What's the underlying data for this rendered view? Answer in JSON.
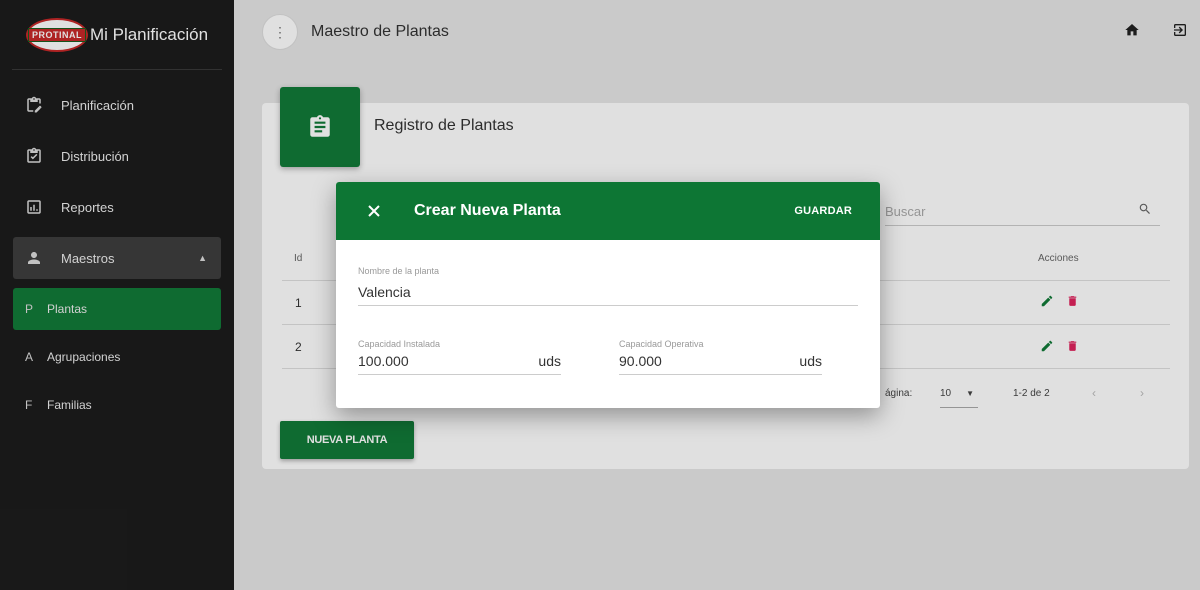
{
  "brand": {
    "logo_text": "PROTINAL",
    "title": "Mi Planificación"
  },
  "sidebar": {
    "items": [
      {
        "label": "Planificación",
        "icon": "clipboard-edit-icon"
      },
      {
        "label": "Distribución",
        "icon": "clipboard-check-icon"
      },
      {
        "label": "Reportes",
        "icon": "report-chart-icon"
      },
      {
        "label": "Maestros",
        "icon": "person-icon"
      }
    ],
    "subitems": [
      {
        "letter": "P",
        "label": "Plantas"
      },
      {
        "letter": "A",
        "label": "Agrupaciones"
      },
      {
        "letter": "F",
        "label": "Familias"
      }
    ]
  },
  "topbar": {
    "menu_glyph": "⋮",
    "title": "Maestro de Plantas"
  },
  "card": {
    "title": "Registro de Plantas",
    "search_placeholder": "Buscar",
    "headers": {
      "id": "Id",
      "actions": "Acciones"
    },
    "rows": [
      {
        "id": "1"
      },
      {
        "id": "2"
      }
    ],
    "pager": {
      "rows_label": "ágina:",
      "per_page": "10",
      "range": "1-2 de 2"
    },
    "new_button": "NUEVA PLANTA"
  },
  "dialog": {
    "title": "Crear Nueva Planta",
    "save_label": "GUARDAR",
    "nombre": {
      "label": "Nombre de la planta",
      "value": "Valencia"
    },
    "cap_instalada": {
      "label": "Capacidad Instalada",
      "value": "100.000",
      "unit": "uds"
    },
    "cap_operativa": {
      "label": "Capacidad Operativa",
      "value": "90.000",
      "unit": "uds"
    }
  },
  "colors": {
    "primary": "#127a38",
    "sidebar": "#1c1c1c",
    "delete": "#e0245e"
  }
}
